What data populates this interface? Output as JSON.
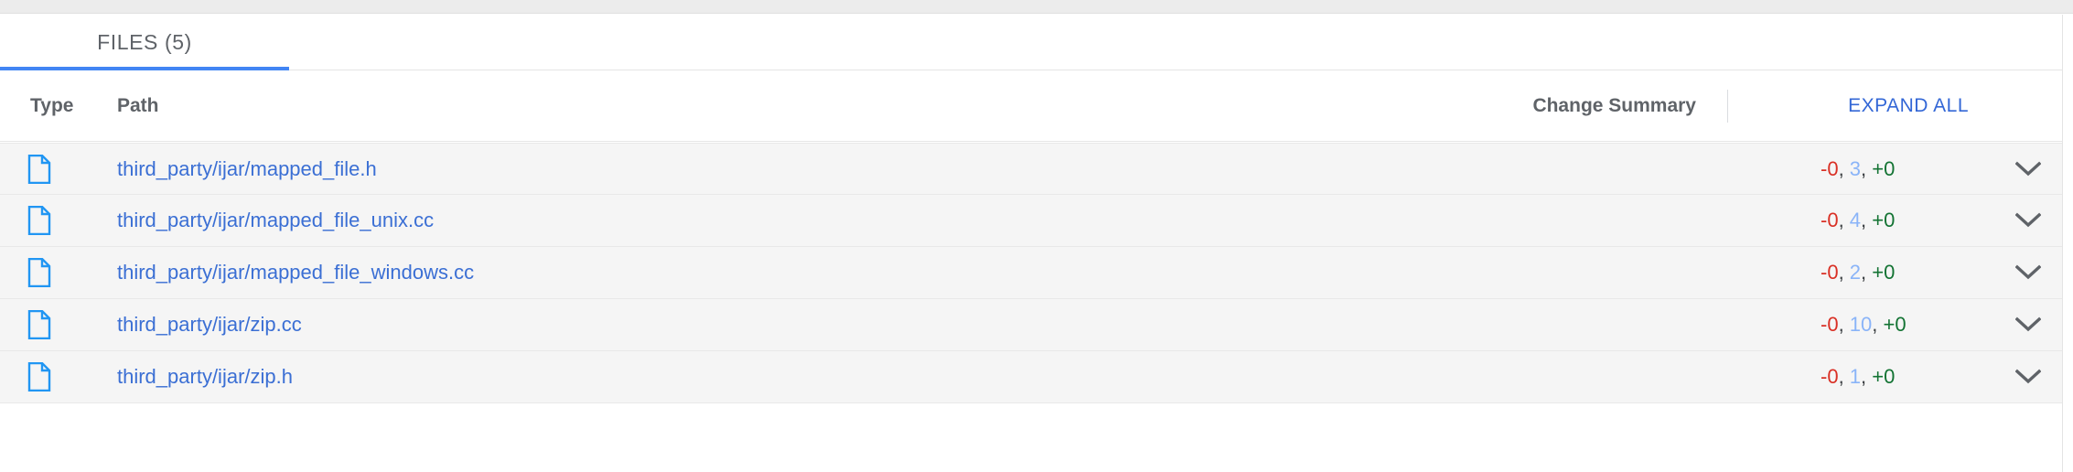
{
  "window": {
    "top_strip_color": "#ececec",
    "background": "#ffffff"
  },
  "tabs": [
    {
      "label": "FILES (5)",
      "selected": true,
      "accent_color": "#4285f4"
    }
  ],
  "table": {
    "columns": {
      "type": "Type",
      "path": "Path",
      "change_summary": "Change Summary"
    },
    "expand_all_label": "EXPAND ALL",
    "expand_all_color": "#3367d6",
    "rows": [
      {
        "icon": "file-icon",
        "path": "third_party/ijar/mapped_file.h",
        "bar_width_pct": 100,
        "deleted": "-0",
        "modified": "3",
        "added": "+0",
        "chevron": "chevron-down-icon"
      },
      {
        "icon": "file-icon",
        "path": "third_party/ijar/mapped_file_unix.cc",
        "bar_width_pct": 100,
        "deleted": "-0",
        "modified": "4",
        "added": "+0",
        "chevron": "chevron-down-icon"
      },
      {
        "icon": "file-icon",
        "path": "third_party/ijar/mapped_file_windows.cc",
        "bar_width_pct": 100,
        "deleted": "-0",
        "modified": "2",
        "added": "+0",
        "chevron": "chevron-down-icon"
      },
      {
        "icon": "file-icon",
        "path": "third_party/ijar/zip.cc",
        "bar_width_pct": 100,
        "deleted": "-0",
        "modified": "10",
        "added": "+0",
        "chevron": "chevron-down-icon"
      },
      {
        "icon": "file-icon",
        "path": "third_party/ijar/zip.h",
        "bar_width_pct": 100,
        "deleted": "-0",
        "modified": "1",
        "added": "+0",
        "chevron": "chevron-down-icon"
      }
    ],
    "separator": ", ",
    "colors": {
      "deleted": "#d93025",
      "modified": "#8ab4f8",
      "added": "#137333",
      "bar": "#91c6f7",
      "path_link": "#3b6fd4",
      "file_icon": "#2196f3",
      "row_background": "#f5f5f5"
    }
  }
}
